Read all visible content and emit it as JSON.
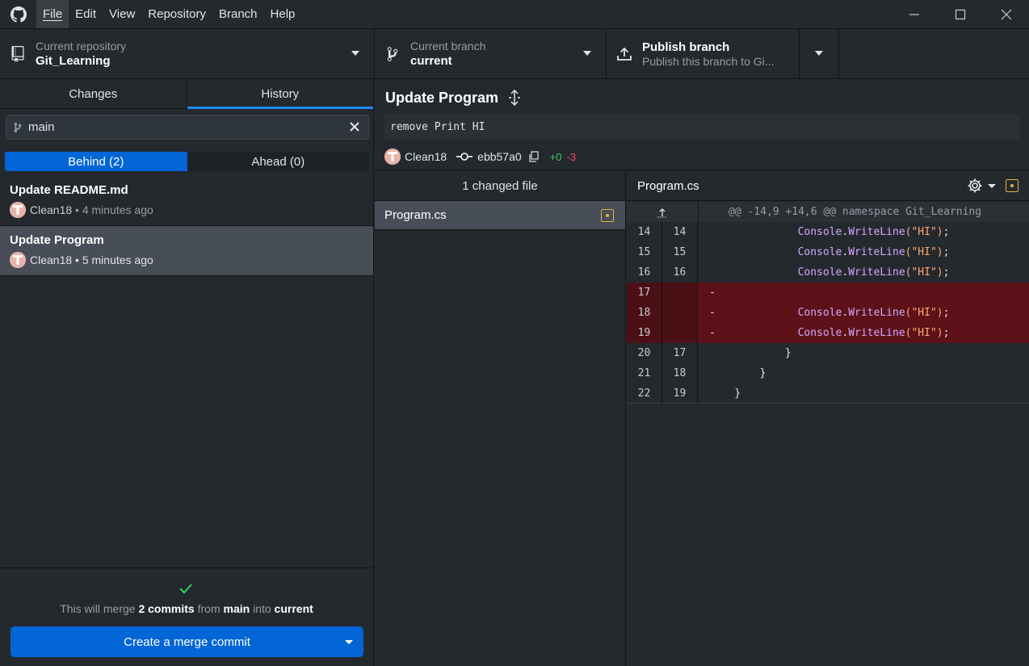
{
  "menu": {
    "file": "File",
    "edit": "Edit",
    "view": "View",
    "repository": "Repository",
    "branch": "Branch",
    "help": "Help"
  },
  "toolbar": {
    "repo_label": "Current repository",
    "repo_name": "Git_Learning",
    "branch_label": "Current branch",
    "branch_name": "current",
    "publish_title": "Publish branch",
    "publish_desc": "Publish this branch to Gi..."
  },
  "tabs": {
    "changes": "Changes",
    "history": "History"
  },
  "filter": {
    "value": "main"
  },
  "compare": {
    "behind": "Behind (2)",
    "ahead": "Ahead (0)"
  },
  "commits": [
    {
      "title": "Update README.md",
      "author": "Clean18",
      "sep": " • ",
      "time": "4 minutes ago"
    },
    {
      "title": "Update Program",
      "author": "Clean18",
      "sep": " • ",
      "time": "5 minutes ago"
    }
  ],
  "merge": {
    "t1": "This will merge ",
    "count": "2 commits",
    "t2": " from ",
    "source": "main",
    "t3": " into ",
    "target": "current",
    "button": "Create a merge commit"
  },
  "selected_commit": {
    "title": "Update Program",
    "description": "remove Print HI",
    "author": "Clean18",
    "sha": "ebb57a0",
    "added": "+0",
    "removed": "-3"
  },
  "files": {
    "header": "1 changed file",
    "items": [
      {
        "name": "Program.cs"
      }
    ]
  },
  "diff": {
    "file": "Program.cs",
    "hunk": "@@ -14,9 +14,6 @@ namespace Git_Learning",
    "lines": [
      {
        "o": "14",
        "n": "14",
        "pre": "              ",
        "obj": "Console",
        "dot": ".",
        "fn": "WriteLine",
        "s": "(\"HI\")",
        "end": ";"
      },
      {
        "o": "15",
        "n": "15",
        "pre": "              ",
        "obj": "Console",
        "dot": ".",
        "fn": "WriteLine",
        "s": "(\"HI\")",
        "end": ";"
      },
      {
        "o": "16",
        "n": "16",
        "pre": "              ",
        "obj": "Console",
        "dot": ".",
        "fn": "WriteLine",
        "s": "(\"HI\")",
        "end": ";"
      },
      {
        "o": "17",
        "n": "",
        "pre": "-",
        "obj": "",
        "dot": "",
        "fn": "",
        "s": "",
        "end": ""
      },
      {
        "o": "18",
        "n": "",
        "pre": "-             ",
        "obj": "Console",
        "dot": ".",
        "fn": "WriteLine",
        "s": "(\"HI\")",
        "end": ";"
      },
      {
        "o": "19",
        "n": "",
        "pre": "-             ",
        "obj": "Console",
        "dot": ".",
        "fn": "WriteLine",
        "s": "(\"HI\")",
        "end": ";"
      },
      {
        "o": "20",
        "n": "17",
        "pre": "            }",
        "obj": "",
        "dot": "",
        "fn": "",
        "s": "",
        "end": ""
      },
      {
        "o": "21",
        "n": "18",
        "pre": "        }",
        "obj": "",
        "dot": "",
        "fn": "",
        "s": "",
        "end": ""
      },
      {
        "o": "22",
        "n": "19",
        "pre": "    }",
        "obj": "",
        "dot": "",
        "fn": "",
        "s": "",
        "end": ""
      }
    ]
  },
  "colors": {
    "accent": "#0366d6",
    "deleted_bg": "#5d1118",
    "added": "#34d058",
    "removed": "#ea4a5a",
    "modified": "#e3b341"
  }
}
